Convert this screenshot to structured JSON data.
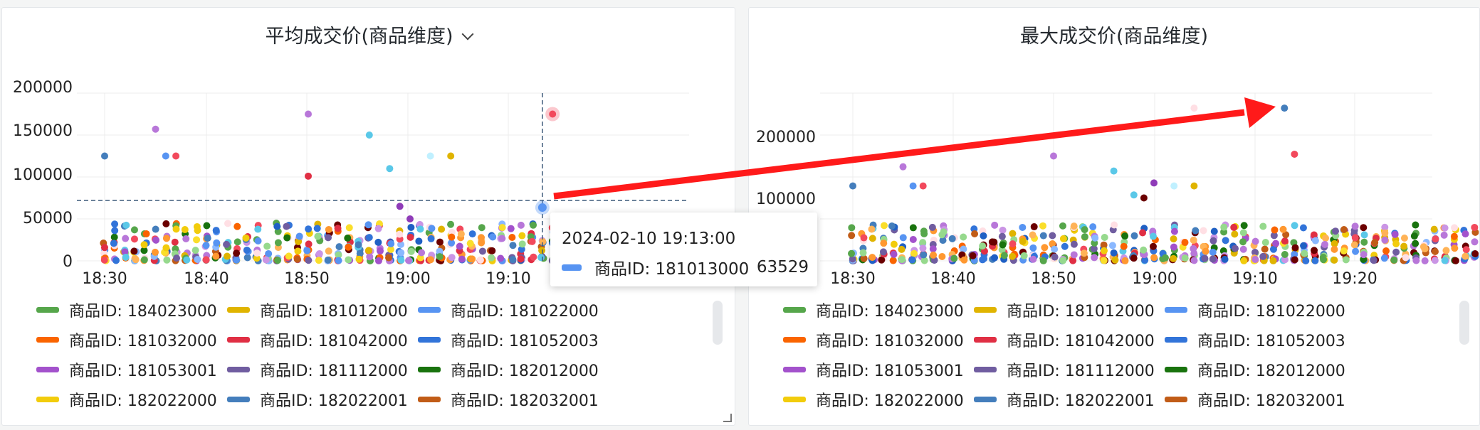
{
  "panels": [
    {
      "title": "平均成交价(商品维度)",
      "has_menu": true
    },
    {
      "title": "最大成交价(商品维度)",
      "has_menu": false
    }
  ],
  "legend": [
    {
      "label": "商品ID: 184023000",
      "color": "#56a64b"
    },
    {
      "label": "商品ID: 181012000",
      "color": "#e0b400"
    },
    {
      "label": "商品ID: 181022000",
      "color": "#5794f2"
    },
    {
      "label": "商品ID: 181032000",
      "color": "#fa6400"
    },
    {
      "label": "商品ID: 181042000",
      "color": "#e02f44"
    },
    {
      "label": "商品ID: 181052003",
      "color": "#3274d9"
    },
    {
      "label": "商品ID: 181053001",
      "color": "#a352cc"
    },
    {
      "label": "商品ID: 181112000",
      "color": "#705da0"
    },
    {
      "label": "商品ID: 182012000",
      "color": "#19730e"
    },
    {
      "label": "商品ID: 182022000",
      "color": "#f2cc0c"
    },
    {
      "label": "商品ID: 182022001",
      "color": "#447ebc"
    },
    {
      "label": "商品ID: 182032001",
      "color": "#c15c17"
    }
  ],
  "tooltip": {
    "time": "2024-02-10 19:13:00",
    "series": "商品ID: 181013000",
    "value": "63529",
    "color": "#5794f2"
  },
  "chart_data": [
    {
      "type": "scatter",
      "title": "平均成交价(商品维度)",
      "x_ticks": [
        "18:30",
        "18:40",
        "18:50",
        "19:00",
        "19:10"
      ],
      "y_ticks": [
        "0",
        "50000",
        "100000",
        "150000",
        "200000"
      ],
      "ylim": [
        0,
        200000
      ],
      "xlim_minutes": [
        18.5,
        69.5
      ],
      "crosshair": {
        "x_minute": 43,
        "y": 72000
      },
      "highlighted_point": {
        "x_minute": 43,
        "y": 63529,
        "color": "#5794f2"
      },
      "points": [
        {
          "x": 0,
          "y": 125000,
          "c": "#447ebc"
        },
        {
          "x": 5,
          "y": 157000,
          "c": "#b877d9"
        },
        {
          "x": 6,
          "y": 125000,
          "c": "#5794f2"
        },
        {
          "x": 7,
          "y": 125000,
          "c": "#f2495c"
        },
        {
          "x": 20,
          "y": 175000,
          "c": "#b877d9"
        },
        {
          "x": 20,
          "y": 101000,
          "c": "#e02f44"
        },
        {
          "x": 26,
          "y": 150000,
          "c": "#5ac8e8"
        },
        {
          "x": 28,
          "y": 110000,
          "c": "#5ac8e8"
        },
        {
          "x": 30,
          "y": 50000,
          "c": "#8f3bb8"
        },
        {
          "x": 32,
          "y": 125000,
          "c": "#c0f0ff"
        },
        {
          "x": 34,
          "y": 125000,
          "c": "#e0b400"
        },
        {
          "x": 44,
          "y": 175000,
          "c": "#f2495c"
        },
        {
          "x": 29,
          "y": 65000,
          "c": "#8f3bb8"
        },
        {
          "x": 41,
          "y": 30000,
          "c": "#f2cc0c"
        },
        {
          "x": 42,
          "y": 23000,
          "c": "#f2495c"
        }
      ],
      "dense_band": [
        0,
        45000
      ]
    },
    {
      "type": "scatter",
      "title": "最大成交价(商品维度)",
      "x_ticks": [
        "18:30",
        "18:40",
        "18:50",
        "19:00",
        "19:10",
        "19:20"
      ],
      "y_ticks": [
        "100000",
        "200000"
      ],
      "ylim": [
        0,
        280000
      ],
      "xlim_minutes": [
        18.5,
        78.5
      ],
      "points": [
        {
          "x": 0,
          "y": 125000,
          "c": "#447ebc"
        },
        {
          "x": 5,
          "y": 157000,
          "c": "#b877d9"
        },
        {
          "x": 6,
          "y": 125000,
          "c": "#5794f2"
        },
        {
          "x": 7,
          "y": 125000,
          "c": "#f2495c"
        },
        {
          "x": 20,
          "y": 175000,
          "c": "#b877d9"
        },
        {
          "x": 26,
          "y": 150000,
          "c": "#5ac8e8"
        },
        {
          "x": 28,
          "y": 110000,
          "c": "#5ac8e8"
        },
        {
          "x": 29,
          "y": 105000,
          "c": "#6b0000"
        },
        {
          "x": 30,
          "y": 130000,
          "c": "#8f3bb8"
        },
        {
          "x": 32,
          "y": 125000,
          "c": "#c0f0ff"
        },
        {
          "x": 34,
          "y": 125000,
          "c": "#e0b400"
        },
        {
          "x": 34,
          "y": 255000,
          "c": "#ffdfe4"
        },
        {
          "x": 43,
          "y": 255000,
          "c": "#447ebc"
        },
        {
          "x": 44,
          "y": 178000,
          "c": "#f2495c"
        }
      ],
      "dense_band": [
        0,
        60000
      ]
    }
  ]
}
